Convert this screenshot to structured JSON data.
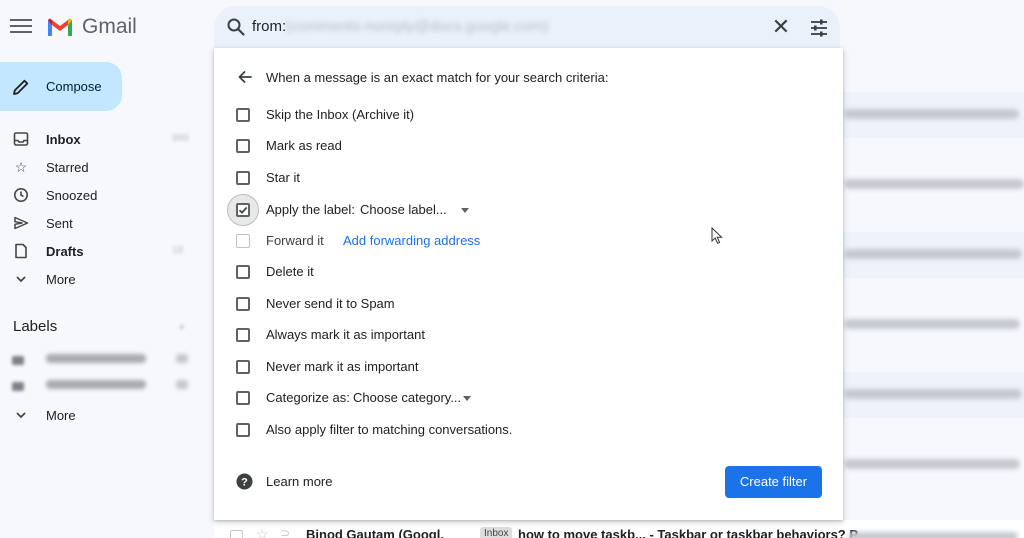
{
  "app": {
    "name": "Gmail"
  },
  "search": {
    "prefix": "from:",
    "query_blurred": "(comments-noreply@docs.google.com)"
  },
  "sidebar": {
    "compose_label": "Compose",
    "items": [
      {
        "label": "Inbox",
        "bold": true,
        "count": "999",
        "icon": "inbox-icon"
      },
      {
        "label": "Starred",
        "icon": "star-icon"
      },
      {
        "label": "Snoozed",
        "icon": "clock-icon"
      },
      {
        "label": "Sent",
        "icon": "send-icon"
      },
      {
        "label": "Drafts",
        "bold": true,
        "count": "18",
        "icon": "draft-icon"
      },
      {
        "label": "More",
        "icon": "chevron-down-icon"
      }
    ],
    "labels_title": "Labels",
    "labels_more": "More"
  },
  "filter_dialog": {
    "header": "When a message is an exact match for your search criteria:",
    "options": [
      {
        "label": "Skip the Inbox (Archive it)",
        "checked": false
      },
      {
        "label": "Mark as read",
        "checked": false
      },
      {
        "label": "Star it",
        "checked": false
      },
      {
        "label": "Apply the label:",
        "checked": true,
        "dropdown": "Choose label..."
      },
      {
        "label": "Forward it",
        "checked": false,
        "disabled": true,
        "link": "Add forwarding address"
      },
      {
        "label": "Delete it",
        "checked": false
      },
      {
        "label": "Never send it to Spam",
        "checked": false
      },
      {
        "label": "Always mark it as important",
        "checked": false
      },
      {
        "label": "Never mark it as important",
        "checked": false
      },
      {
        "label": "Categorize as:",
        "checked": false,
        "dropdown": "Choose category..."
      },
      {
        "label": "Also apply filter to matching conversations.",
        "checked": false
      }
    ],
    "learn_more": "Learn more",
    "create_filter": "Create filter"
  },
  "email_list": {
    "visible_row": {
      "sender": "Binod Gautam (Googl.",
      "badge": "Inbox",
      "subject": "how to move taskb... - Taskbar or taskbar behaviors? P"
    }
  },
  "colors": {
    "accent": "#1a73e8",
    "compose_bg": "#c2e7ff",
    "search_bg": "#eaf1fb",
    "page_bg": "#f6f8fc"
  }
}
